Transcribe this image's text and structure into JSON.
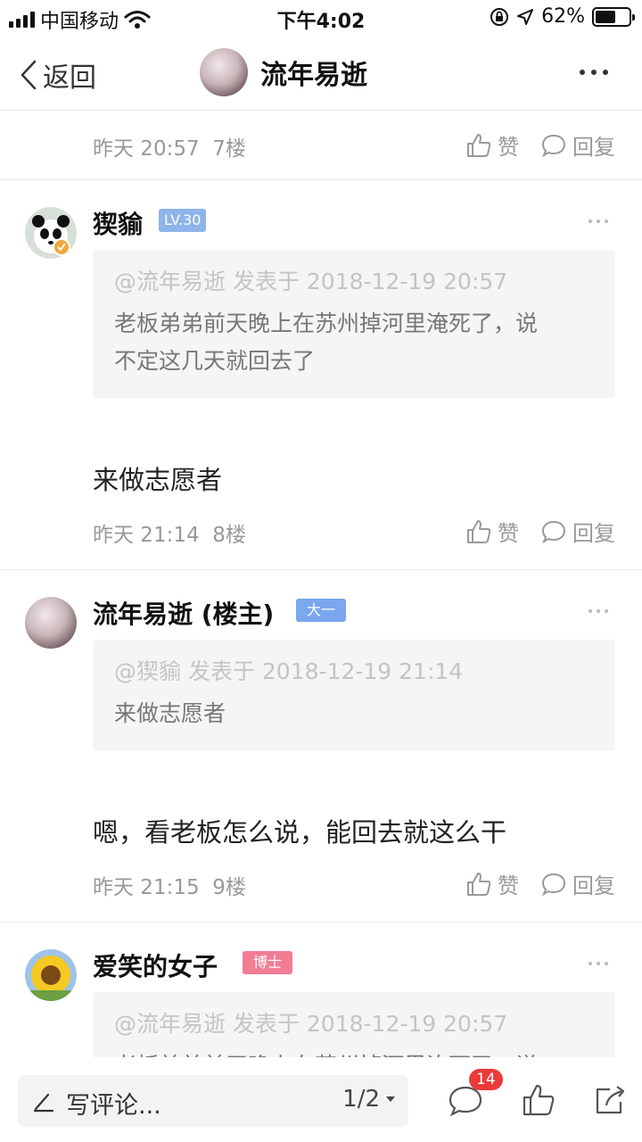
{
  "status_bar": {
    "carrier": "中国移动",
    "time": "下午4:02",
    "battery": "62%",
    "battery_level": 0.62
  },
  "nav": {
    "back_label": "返回",
    "title": "流年易逝"
  },
  "first_meta": {
    "time": "昨天 20:57",
    "floor": "7楼",
    "like": "赞",
    "reply": "回复"
  },
  "comments": [
    {
      "name": "猰貐",
      "badge": "LV.30",
      "badge_color": "#8fb4ea",
      "quote_head": "@流年易逝 发表于 2018-12-19 20:57",
      "quote_body_line1": "老板弟弟前天晚上在苏州掉河里淹死了，说",
      "quote_body_line2": "不定这几天就回去了",
      "body": "来做志愿者",
      "time": "昨天 21:14",
      "floor": "8楼",
      "like": "赞",
      "reply": "回复"
    },
    {
      "name": "流年易逝 (楼主)",
      "badge": "大一",
      "badge_color": "#7aa7ee",
      "quote_head": "@猰貐 发表于 2018-12-19 21:14",
      "quote_body_line1": "来做志愿者",
      "body": "嗯，看老板怎么说，能回去就这么干",
      "time": "昨天 21:15",
      "floor": "9楼",
      "like": "赞",
      "reply": "回复"
    },
    {
      "name": "爱笑的女子",
      "badge": "博士",
      "badge_color": "#f17d95",
      "quote_head": "@流年易逝 发表于 2018-12-19 20:57",
      "quote_body_line1": "老板弟弟前天晚上在苏州掉河里淹死了，说"
    }
  ],
  "bottom_bar": {
    "placeholder": "写评论...",
    "page": "1/2",
    "comment_count": "14"
  }
}
